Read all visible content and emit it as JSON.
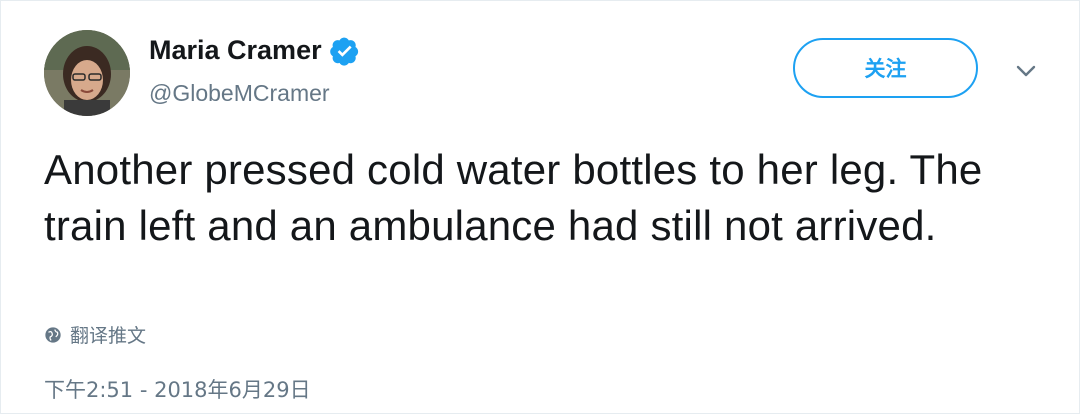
{
  "user": {
    "display_name": "Maria Cramer",
    "handle": "@GlobeMCramer",
    "verified": true,
    "avatar_icon": "user-avatar"
  },
  "actions": {
    "follow_label": "关注",
    "menu_icon": "chevron-down-icon"
  },
  "tweet": {
    "text": "Another pressed cold water bottles to her leg. The train left and an ambulance had still not arrived.",
    "translate_label": "翻译推文",
    "timestamp": "下午2:51 - 2018年6月29日"
  },
  "colors": {
    "accent": "#1da1f2",
    "text": "#14171a",
    "secondary": "#657786"
  }
}
